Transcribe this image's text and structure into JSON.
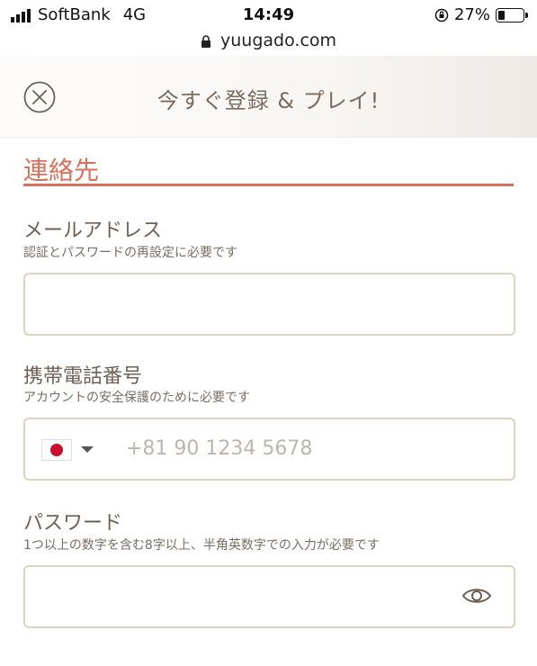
{
  "status_bar": {
    "carrier": "SoftBank",
    "network": "4G",
    "time": "14:49",
    "battery_percent": "27%",
    "battery_level": 0.27
  },
  "browser": {
    "url": "yuugado.com"
  },
  "header": {
    "title": "今すぐ登録 & プレイ!",
    "close_icon": "close-circle-icon"
  },
  "section": {
    "title": "連絡先"
  },
  "email": {
    "label": "メールアドレス",
    "sublabel": "認証とパスワードの再設定に必要です",
    "value": ""
  },
  "phone": {
    "label": "携帯電話番号",
    "sublabel": "アカウントの安全保護のために必要です",
    "country_flag": "japan-flag-icon",
    "placeholder": "+81 90 1234 5678"
  },
  "password": {
    "label": "パスワード",
    "sublabel": "1つ以上の数字を含む8字以上、半角英数字での入力が必要です",
    "value": "",
    "toggle_icon": "eye-icon"
  },
  "colors": {
    "accent": "#d8715a",
    "label": "#6f5f54",
    "border": "#ddd3c3"
  }
}
